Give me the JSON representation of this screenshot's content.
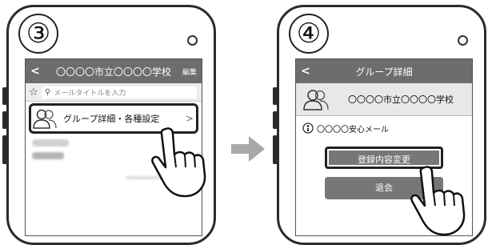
{
  "steps": {
    "left": "③",
    "right": "④"
  },
  "screen1": {
    "header": {
      "back_icon": "chevron-left-icon",
      "title": "〇〇〇〇市立〇〇〇〇学校",
      "edit_label": "編集"
    },
    "search": {
      "placeholder": "メールタイトルを入力"
    },
    "menu": {
      "label": "グループ詳細・各種設定"
    }
  },
  "screen2": {
    "header": {
      "title": "グループ詳細"
    },
    "group_name": "〇〇〇〇市立〇〇〇〇学校",
    "notice_name": "〇〇〇〇安心メール",
    "buttons": {
      "update": "登録内容変更",
      "leave": "退会"
    }
  },
  "colors": {
    "header_bg": "#6d6d6d",
    "button_bg": "#777777",
    "arrow": "#a9a9a9"
  }
}
